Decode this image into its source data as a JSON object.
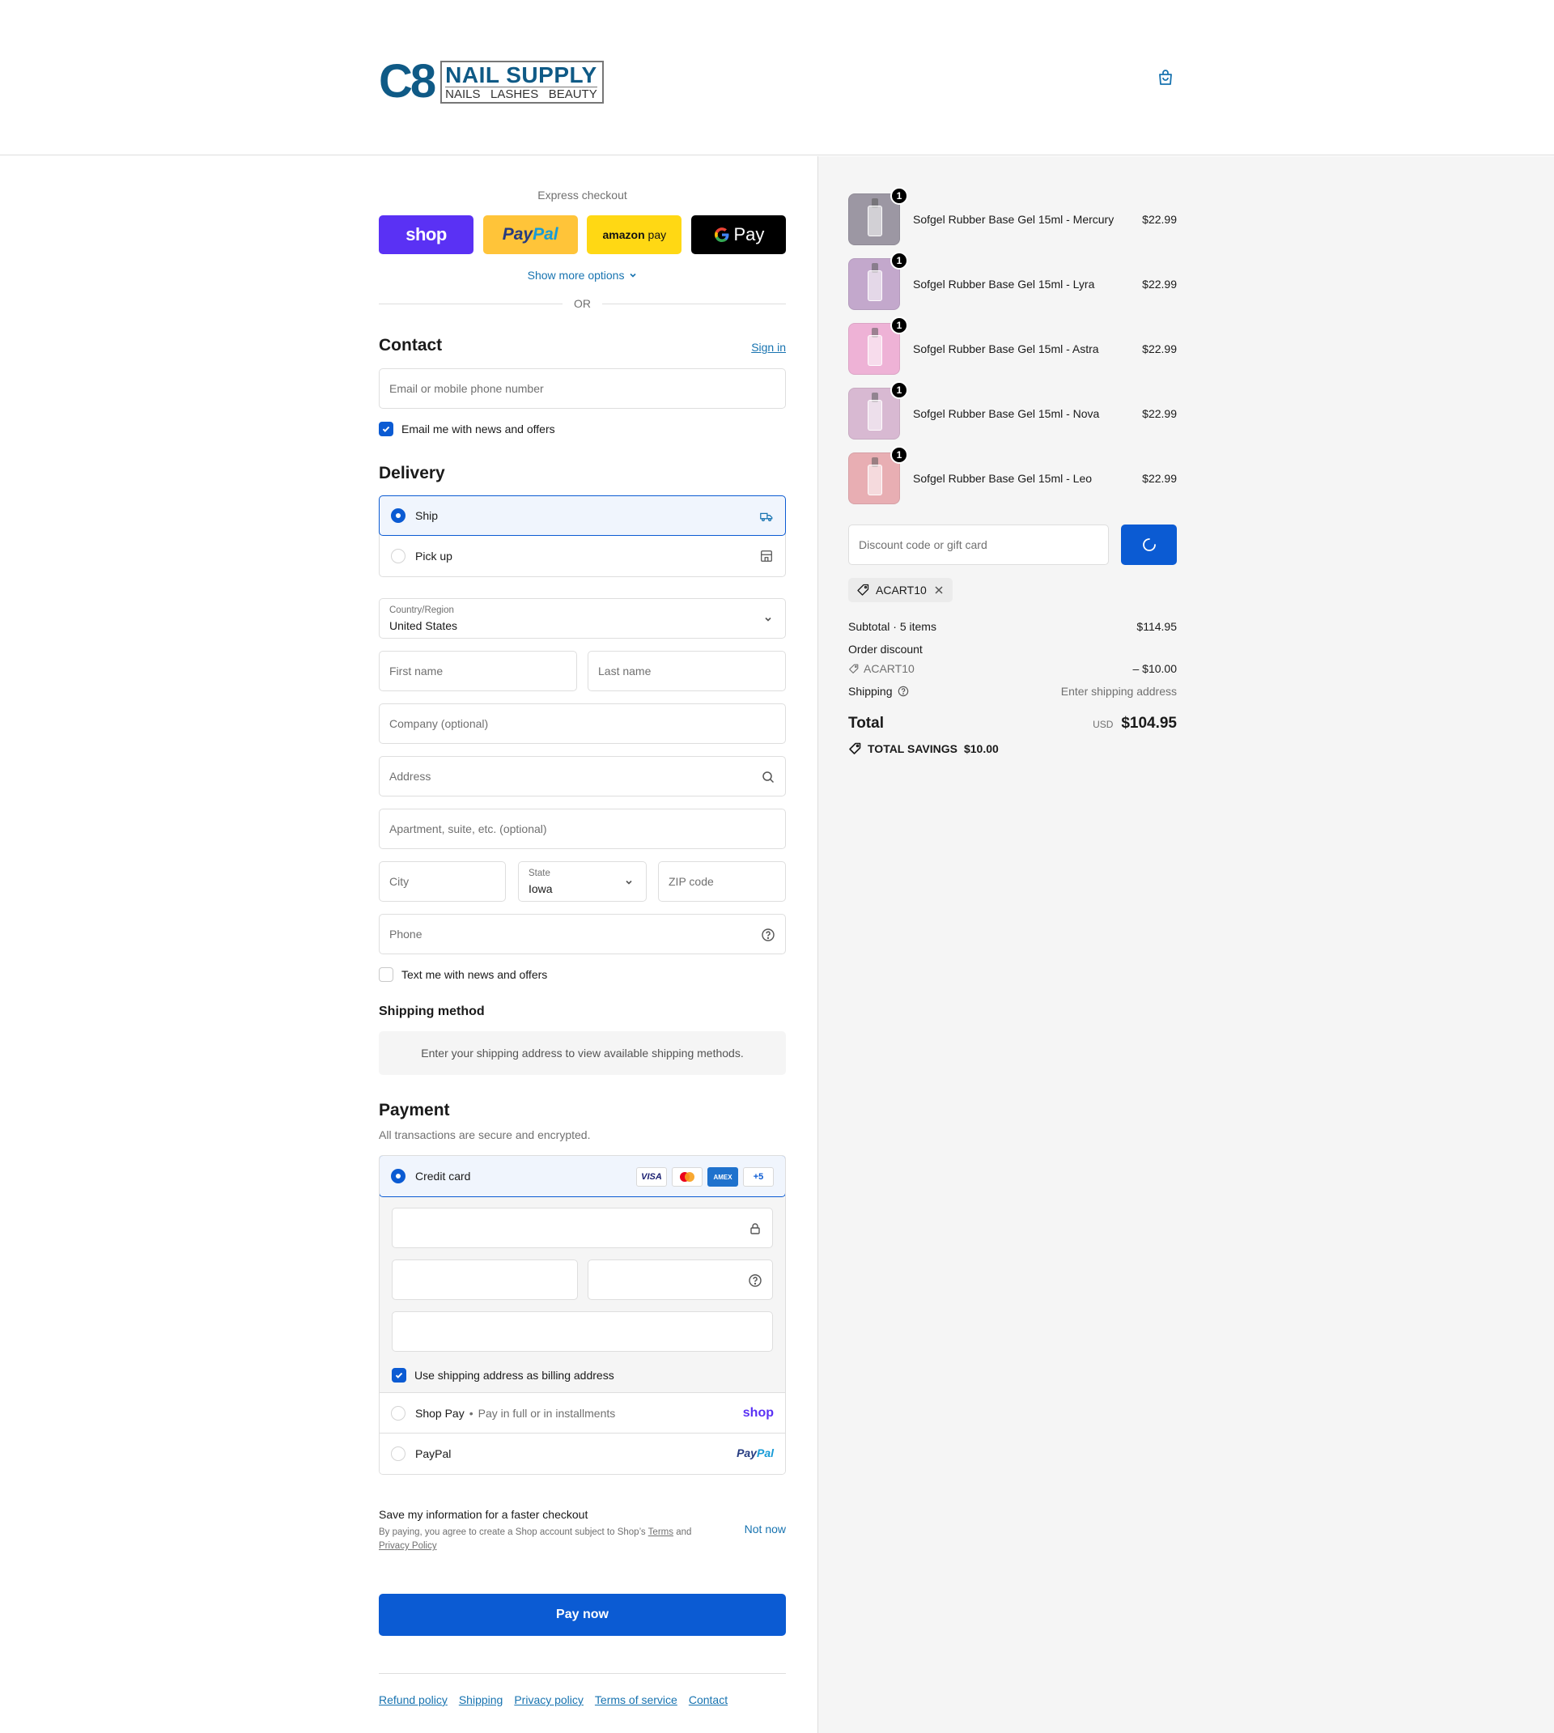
{
  "header": {
    "logo_main": "C8",
    "logo_title": "NAIL SUPPLY",
    "logo_sub": [
      "NAILS",
      "LASHES",
      "BEAUTY"
    ]
  },
  "express": {
    "title": "Express checkout",
    "shop_label": "shop",
    "paypal_1": "Pay",
    "paypal_2": "Pal",
    "amazon_1": "amazon",
    "amazon_2": "pay",
    "gpay_label": "Pay",
    "show_more": "Show more options",
    "or": "OR"
  },
  "contact": {
    "title": "Contact",
    "sign_in": "Sign in",
    "email_placeholder": "Email or mobile phone number",
    "email_news": "Email me with news and offers"
  },
  "delivery": {
    "title": "Delivery",
    "options": [
      "Ship",
      "Pick up"
    ],
    "country_label": "Country/Region",
    "country_value": "United States",
    "first_name": "First name",
    "last_name": "Last name",
    "company": "Company (optional)",
    "address": "Address",
    "apartment": "Apartment, suite, etc. (optional)",
    "city": "City",
    "state_label": "State",
    "state_value": "Iowa",
    "zip": "ZIP code",
    "phone": "Phone",
    "text_news": "Text me with news and offers"
  },
  "shipping_method": {
    "title": "Shipping method",
    "info": "Enter your shipping address to view available shipping methods."
  },
  "payment": {
    "title": "Payment",
    "subtitle": "All transactions are secure and encrypted.",
    "credit_card": "Credit card",
    "cards": [
      "VISA",
      "AMEX",
      "+5"
    ],
    "billing_same": "Use shipping address as billing address",
    "shop_pay": "Shop Pay",
    "shop_pay_sub": "Pay in full or in installments",
    "shop_brand": "shop",
    "paypal": "PayPal",
    "paypal_brand_1": "Pay",
    "paypal_brand_2": "Pal"
  },
  "save_info": {
    "title": "Save my information for a faster checkout",
    "desc": "By paying, you agree to create a Shop account subject to Shop’s",
    "terms": "Terms",
    "and": "and",
    "privacy": "Privacy Policy",
    "not_now": "Not now"
  },
  "pay_now": "Pay now",
  "footer_links": [
    "Refund policy",
    "Shipping",
    "Privacy policy",
    "Terms of service",
    "Contact"
  ],
  "cart": {
    "items": [
      {
        "name": "Sofgel Rubber Base Gel 15ml - Mercury",
        "price": "$22.99",
        "qty": "1",
        "color": "#9c97a3"
      },
      {
        "name": "Sofgel Rubber Base Gel 15ml - Lyra",
        "price": "$22.99",
        "qty": "1",
        "color": "#c3a8cc"
      },
      {
        "name": "Sofgel Rubber Base Gel 15ml - Astra",
        "price": "$22.99",
        "qty": "1",
        "color": "#eeb2d6"
      },
      {
        "name": "Sofgel Rubber Base Gel 15ml - Nova",
        "price": "$22.99",
        "qty": "1",
        "color": "#d8b9d2"
      },
      {
        "name": "Sofgel Rubber Base Gel 15ml - Leo",
        "price": "$22.99",
        "qty": "1",
        "color": "#e8aeb3"
      }
    ],
    "discount_placeholder": "Discount code or gift card",
    "applied_code": "ACART10",
    "subtotal_label": "Subtotal · 5 items",
    "subtotal_value": "$114.95",
    "order_discount_label": "Order discount",
    "order_discount_code": "ACART10",
    "order_discount_value": "– $10.00",
    "shipping_label": "Shipping",
    "shipping_value": "Enter shipping address",
    "total_label": "Total",
    "total_currency": "USD",
    "total_value": "$104.95",
    "savings_label": "TOTAL SAVINGS",
    "savings_value": "$10.00"
  },
  "colors": {
    "accent": "#0b5bd3",
    "link": "#1773b0",
    "shop_purple": "#5a31f4",
    "paypal_yellow": "#ffc439",
    "amazon_yellow": "#ffd814"
  }
}
